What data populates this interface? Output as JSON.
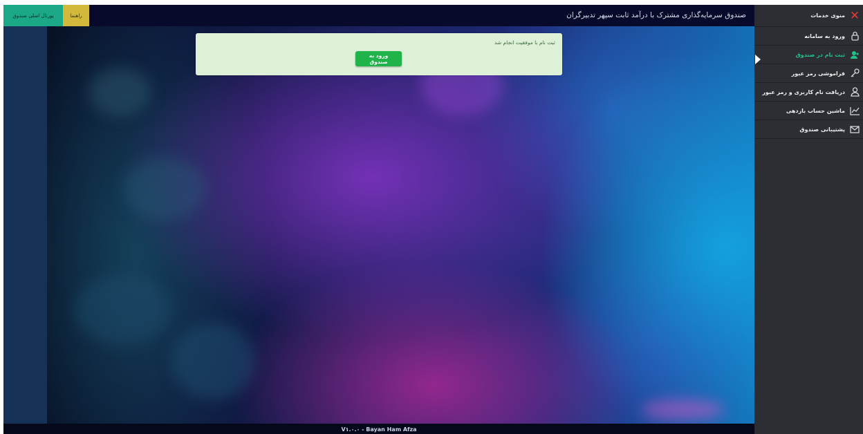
{
  "topbar": {
    "title": "صندوق سرمایه‌گذاری مشترک با درآمد ثابت سپهر تدبیرگران",
    "portal_button": "پورتال اصلی صندوق",
    "help_button": "راهنما"
  },
  "sidebar": {
    "header": {
      "label": "منوی خدمات",
      "icon": "close-icon"
    },
    "items": [
      {
        "label": "ورود به سامانه",
        "icon": "lock-icon",
        "active": false
      },
      {
        "label": "ثبت نام در صندوق",
        "icon": "user-add-icon",
        "active": true
      },
      {
        "label": "فراموشی رمز عبور",
        "icon": "key-icon",
        "active": false
      },
      {
        "label": "دریافت نام کاربری و رمز عبور",
        "icon": "user-lock-icon",
        "active": false
      },
      {
        "label": "ماشین حساب بازدهی",
        "icon": "chart-icon",
        "active": false
      },
      {
        "label": "پشتیبانی صندوق",
        "icon": "mail-icon",
        "active": false
      }
    ],
    "active_color": "#22c38a"
  },
  "modal": {
    "message": "ثبت نام با موفقیت انجام شد",
    "button": "ورود به صندوق",
    "bg_color": "#dff0d8",
    "button_color": "#20b34a"
  },
  "footer": {
    "text": "V۱.۰.۰ - Bayan Ham Afza"
  }
}
